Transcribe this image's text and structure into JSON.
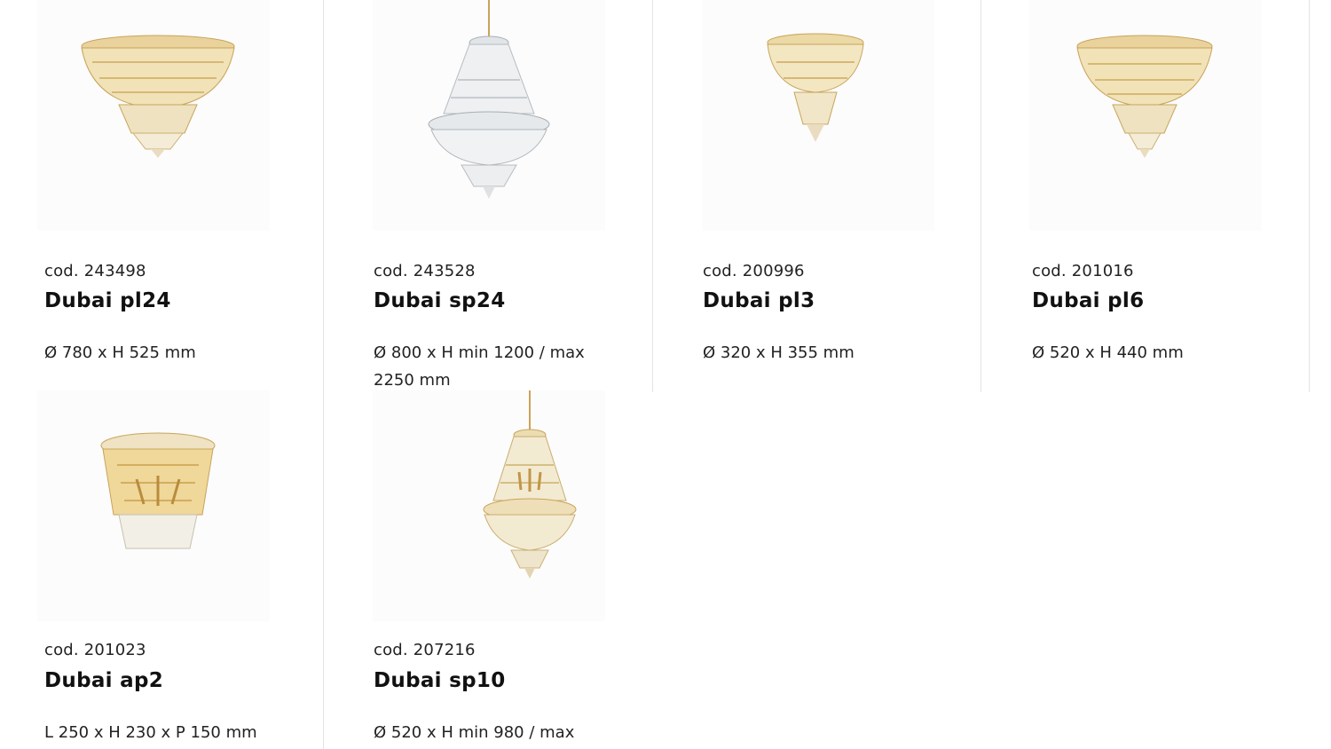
{
  "products": [
    {
      "code": "cod. 243498",
      "name": "Dubai pl24",
      "dims": "Ø 780 x H 525 mm",
      "image_icon": "ceiling-chandelier-icon",
      "finish": "gold"
    },
    {
      "code": "cod. 243528",
      "name": "Dubai sp24",
      "dims": "Ø 800 x H min 1200 / max 2250 mm",
      "image_icon": "pendant-chandelier-icon",
      "finish": "chrome"
    },
    {
      "code": "cod. 200996",
      "name": "Dubai pl3",
      "dims": "Ø 320 x H 355 mm",
      "image_icon": "ceiling-chandelier-icon",
      "finish": "gold"
    },
    {
      "code": "cod. 201016",
      "name": "Dubai pl6",
      "dims": "Ø 520 x H 440 mm",
      "image_icon": "ceiling-chandelier-icon",
      "finish": "gold"
    },
    {
      "code": "cod. 201023",
      "name": "Dubai ap2",
      "dims": "L 250 x H 230 x P 150 mm",
      "image_icon": "wall-lamp-icon",
      "finish": "gold"
    },
    {
      "code": "cod. 207216",
      "name": "Dubai sp10",
      "dims": "Ø 520 x H min 980 / max",
      "image_icon": "pendant-chandelier-icon",
      "finish": "gold"
    }
  ],
  "colors": {
    "gold": "#d9b56a",
    "chrome": "#cfd3d6",
    "crystal": "#f3ead2",
    "divider": "#e3e3e3"
  }
}
